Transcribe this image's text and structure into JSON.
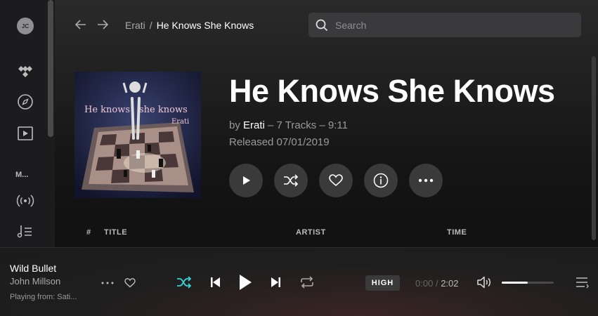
{
  "sidebar": {
    "avatar_initials": "JC",
    "section_label": "M...",
    "icons": [
      "tidal-logo-icon",
      "explore-icon",
      "video-icon",
      "live-broadcast-icon",
      "playlist-icon"
    ]
  },
  "header": {
    "breadcrumb": {
      "parent": "Erati",
      "separator": "/",
      "current": "He Knows She Knows"
    },
    "search_placeholder": "Search"
  },
  "album": {
    "title": "He Knows She Knows",
    "by_prefix": "by",
    "artist": "Erati",
    "tracks_info": "– 7 Tracks – 9:11",
    "released": "Released 07/01/2019",
    "cover_text": {
      "left": "He knows",
      "right": "she knows",
      "artist": "Erati"
    }
  },
  "actions": [
    "play-icon",
    "shuffle-icon",
    "heart-icon",
    "info-icon",
    "more-icon"
  ],
  "table": {
    "headers": {
      "number": "#",
      "title": "TITLE",
      "artist": "ARTIST",
      "time": "TIME"
    }
  },
  "player": {
    "track_title": "Wild Bullet",
    "track_artist": "John Millson",
    "playing_from": "Playing from: Sati...",
    "quality": "HIGH",
    "elapsed": "0:00",
    "time_separator": "/",
    "duration": "2:02",
    "volume": 0.5,
    "accent_color": "#33d3d6"
  }
}
